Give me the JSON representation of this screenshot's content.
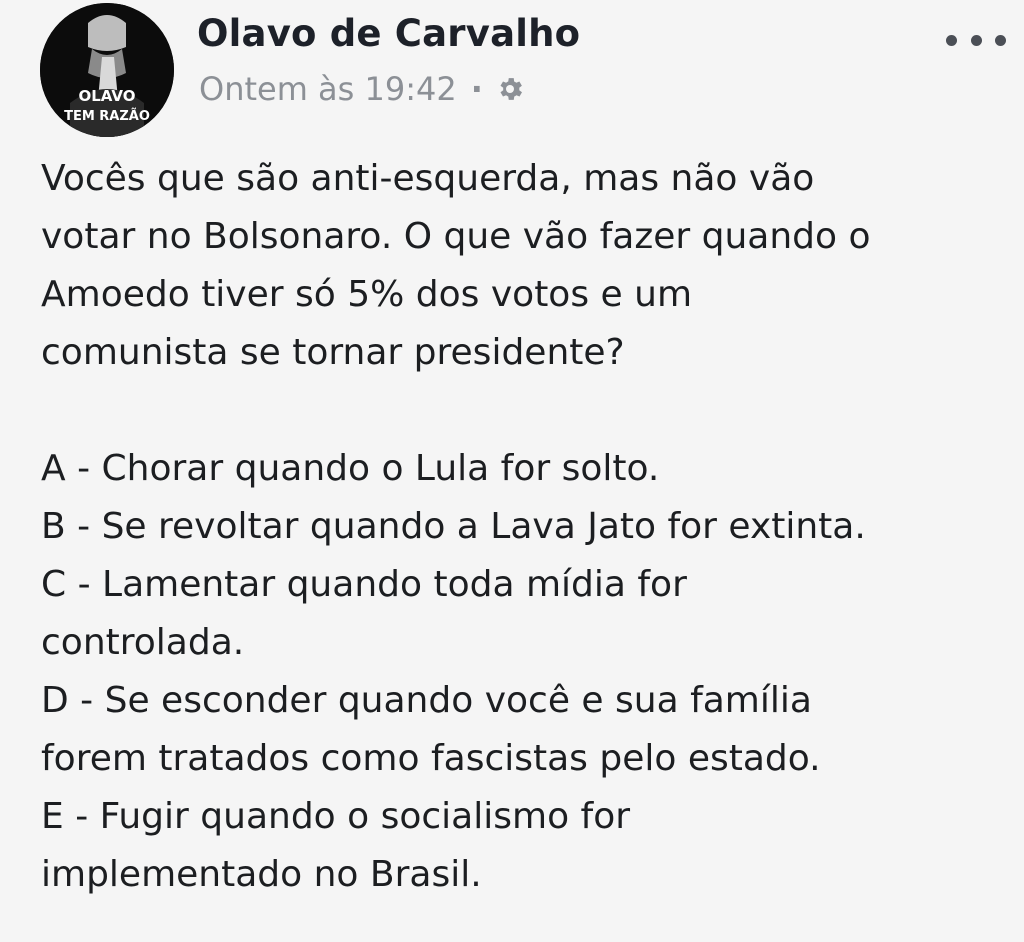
{
  "author": {
    "name": "Olavo de Carvalho",
    "avatar_text_line1": "OLAVO",
    "avatar_text_line2": "TEM RAZÃO"
  },
  "meta": {
    "timestamp": "Ontem às 19:42",
    "separator": "·",
    "privacy_icon": "gear-icon"
  },
  "post": {
    "intro_lines": [
      "Vocês que são anti-esquerda, mas não vão",
      "votar no Bolsonaro. O que vão fazer quando o",
      "Amoedo tiver só 5% dos votos e um",
      "comunista se tornar presidente?"
    ],
    "options": [
      [
        "A - Chorar quando o Lula for solto."
      ],
      [
        "B - Se revoltar quando a Lava Jato for extinta."
      ],
      [
        "C - Lamentar quando toda mídia for",
        "controlada."
      ],
      [
        "D - Se esconder quando você e sua família",
        "forem tratados como fascistas pelo estado."
      ],
      [
        "E - Fugir quando o socialismo for",
        "implementado no Brasil."
      ]
    ]
  },
  "colors": {
    "background": "#f5f5f5",
    "name": "#1d2129",
    "meta": "#8c9096",
    "body_text": "#1c1e21"
  }
}
